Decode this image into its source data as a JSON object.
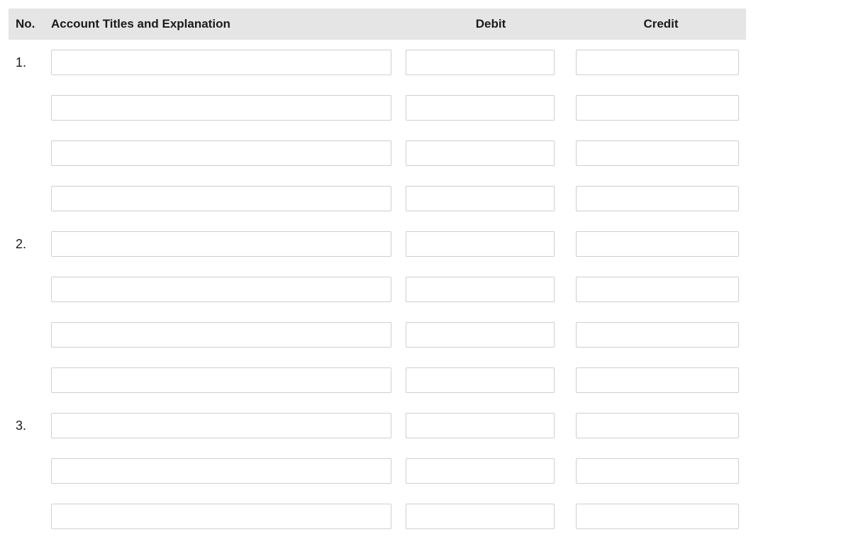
{
  "header": {
    "no": "No.",
    "account": "Account Titles and Explanation",
    "debit": "Debit",
    "credit": "Credit"
  },
  "entries": [
    {
      "no": "1.",
      "rows": [
        {
          "account": "",
          "debit": "",
          "credit": ""
        },
        {
          "account": "",
          "debit": "",
          "credit": ""
        },
        {
          "account": "",
          "debit": "",
          "credit": ""
        },
        {
          "account": "",
          "debit": "",
          "credit": ""
        }
      ]
    },
    {
      "no": "2.",
      "rows": [
        {
          "account": "",
          "debit": "",
          "credit": ""
        },
        {
          "account": "",
          "debit": "",
          "credit": ""
        },
        {
          "account": "",
          "debit": "",
          "credit": ""
        },
        {
          "account": "",
          "debit": "",
          "credit": ""
        }
      ]
    },
    {
      "no": "3.",
      "rows": [
        {
          "account": "",
          "debit": "",
          "credit": ""
        },
        {
          "account": "",
          "debit": "",
          "credit": ""
        },
        {
          "account": "",
          "debit": "",
          "credit": ""
        }
      ]
    }
  ]
}
